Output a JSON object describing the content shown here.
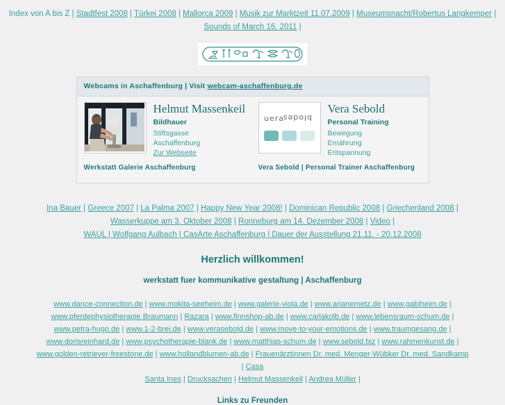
{
  "topnav": {
    "rows": [
      [
        {
          "text": "Index von A bis Z",
          "link": false
        },
        {
          "text": " | ",
          "sep": true
        },
        {
          "text": "Stadtfest 2008",
          "link": true
        },
        {
          "text": " | ",
          "sep": true
        },
        {
          "text": "Türkei 2008",
          "link": true
        },
        {
          "text": " | ",
          "sep": true
        },
        {
          "text": "Mallorca 2009",
          "link": true
        },
        {
          "text": " | ",
          "sep": true
        },
        {
          "text": "Musik zur Marktzeit 11.07.2009",
          "link": true
        },
        {
          "text": " | ",
          "sep": true
        },
        {
          "text": "Museumsnacht/Robertus Langkemper",
          "link": true
        },
        {
          "text": " |",
          "sep": true
        }
      ],
      [
        {
          "text": "Sounds of March 16, 2011",
          "link": true
        },
        {
          "text": " |",
          "sep": true
        }
      ]
    ]
  },
  "banner": {
    "name": "hieroglyph-cartouche-logo",
    "alt": "Hieroglyphic cartouche banner"
  },
  "panel": {
    "header_prefix": "Webcams in Aschaffenburg | Visit ",
    "header_link": "webcam-aschaffenburg.de",
    "cards": [
      {
        "image_name": "sculptor-at-work-photo",
        "name": "Helmut Massenkeil",
        "role": "Bildhauer",
        "lines": [
          "Stiftsgasse",
          "Aschaffenburg"
        ],
        "link": "Zur Webseite",
        "caption": "Werkstatt Galerie Aschaffenburg"
      },
      {
        "image_name": "vera-sebold-logo",
        "logo_text": "vera sebold",
        "name": "Vera Sebold",
        "role": "Personal Training",
        "lines": [
          "Bewegung",
          "Ernährung",
          "Entspannung"
        ],
        "link": "",
        "caption": "Vera Sebold | Personal Trainer Aschaffenburg"
      }
    ]
  },
  "midlinks": {
    "rows": [
      [
        {
          "text": "Ina Bauer",
          "link": true
        },
        {
          "text": " | ",
          "sep": true
        },
        {
          "text": "Greece 2007",
          "link": true
        },
        {
          "text": " | ",
          "sep": true
        },
        {
          "text": "La Palma 2007",
          "link": true
        },
        {
          "text": " | ",
          "sep": true
        },
        {
          "text": "Happy New Year 2008!",
          "link": true
        },
        {
          "text": " | ",
          "sep": true
        },
        {
          "text": "Dominican Republic 2008",
          "link": true
        },
        {
          "text": " | ",
          "sep": true
        },
        {
          "text": "Griechenland 2008",
          "link": true
        },
        {
          "text": " |",
          "sep": true
        }
      ],
      [
        {
          "text": "Wasserkuppe am 3. Oktober 2008",
          "link": true
        },
        {
          "text": " | ",
          "sep": true
        },
        {
          "text": "Ronneburg am 14. Dezember 2008",
          "link": true
        },
        {
          "text": " | ",
          "sep": true
        },
        {
          "text": "Video",
          "link": true
        },
        {
          "text": " |",
          "sep": true
        }
      ],
      [
        {
          "text": "WAUL | Wolfgang Aulbach | CasArte Aschaffenburg | Dauer der Ausstellung 21.11. - 20.12.2008",
          "link": true
        }
      ]
    ]
  },
  "welcome": "Herzlich willkommen!",
  "subtitle": "werkstatt fuer kommunikative gestaltung | Aschaffenburg",
  "friendlinks": {
    "rows": [
      [
        {
          "text": "www.dance-connection.de",
          "link": true
        },
        {
          "text": " | ",
          "sep": true
        },
        {
          "text": "www.mokita-seeheim.de",
          "link": true
        },
        {
          "text": " | ",
          "sep": true
        },
        {
          "text": "www.galerie-viola.de",
          "link": true
        },
        {
          "text": " | ",
          "sep": true
        },
        {
          "text": "www.arianemetz.de",
          "link": true
        },
        {
          "text": " | ",
          "sep": true
        },
        {
          "text": "www.gabiheim.de",
          "link": true
        },
        {
          "text": " |",
          "sep": true
        }
      ],
      [
        {
          "text": "www.pferdephysiotherapie Braumann",
          "link": true
        },
        {
          "text": " | ",
          "sep": true
        },
        {
          "text": "Razara",
          "link": true
        },
        {
          "text": " | ",
          "sep": true
        },
        {
          "text": "www.finnshop-ab.de",
          "link": true
        },
        {
          "text": " | ",
          "sep": true
        },
        {
          "text": "www.carlakolb.de",
          "link": true
        },
        {
          "text": " | ",
          "sep": true
        },
        {
          "text": "www.lebensraum-schum.de",
          "link": true
        },
        {
          "text": " |",
          "sep": true
        }
      ],
      [
        {
          "text": "www.petra-hugo.de",
          "link": true
        },
        {
          "text": " | ",
          "sep": true
        },
        {
          "text": "www.1-2-brei.de",
          "link": true
        },
        {
          "text": " | ",
          "sep": true
        },
        {
          "text": "www.verasebold.de",
          "link": true
        },
        {
          "text": " | ",
          "sep": true
        },
        {
          "text": "www.move-to-your-emotions.de",
          "link": true
        },
        {
          "text": " | ",
          "sep": true
        },
        {
          "text": "www.traumgesang.de",
          "link": true
        },
        {
          "text": " |",
          "sep": true
        }
      ],
      [
        {
          "text": "www.dorisreinhard.de",
          "link": true
        },
        {
          "text": " | ",
          "sep": true
        },
        {
          "text": "www.psychotherapie-blank.de",
          "link": true
        },
        {
          "text": " | ",
          "sep": true
        },
        {
          "text": "www.matthias-schum.de",
          "link": true
        },
        {
          "text": " | ",
          "sep": true
        },
        {
          "text": "www.sebold.biz",
          "link": true
        },
        {
          "text": " | ",
          "sep": true
        },
        {
          "text": "www.rahmenkunst.de",
          "link": true
        },
        {
          "text": " |",
          "sep": true
        }
      ],
      [
        {
          "text": "www.golden-retriever-freestone.de",
          "link": true
        },
        {
          "text": " | ",
          "sep": true
        },
        {
          "text": "www.hollandblumen-ab.de",
          "link": true
        },
        {
          "text": " | ",
          "sep": true
        },
        {
          "text": "Frauenärztinnen Dr. med. Menger-Wübker Dr. med. Sandkamp",
          "link": true
        },
        {
          "text": " | ",
          "sep": true
        },
        {
          "text": "Casa",
          "link": true
        }
      ],
      [
        {
          "text": "Santa Ines",
          "link": true
        },
        {
          "text": " | ",
          "sep": true
        },
        {
          "text": "Drucksachen",
          "link": true
        },
        {
          "text": " | ",
          "sep": true
        },
        {
          "text": "Helmut Massenkeil",
          "link": true
        },
        {
          "text": " | ",
          "sep": true
        },
        {
          "text": "Andrea Müller",
          "link": true
        },
        {
          "text": " |",
          "sep": true
        }
      ]
    ]
  },
  "footer_title": "Links zu Freunden",
  "colors": {
    "link": "#3aa0a0",
    "heading": "#1e7878",
    "page_bg": "#f0f0f0",
    "panel_head_bg": "#e2e8ec",
    "panel_bg": "#f4f4f4",
    "panel_border": "#d2d8dc",
    "logo_sq1": "#74b8b8",
    "logo_sq2": "#b2d9d9",
    "logo_sq3": "#d9ecec"
  }
}
